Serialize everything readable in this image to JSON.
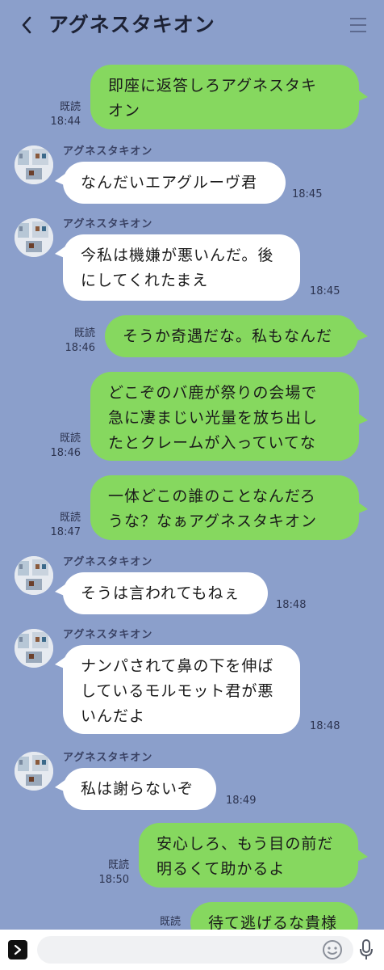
{
  "header": {
    "title": "アグネスタキオン",
    "icons": {
      "back": "chevron-left-icon",
      "menu": "hamburger-menu-icon"
    }
  },
  "colors": {
    "background": "#8b9fcb",
    "outgoing_bubble": "#86d85f",
    "incoming_bubble": "#ffffff"
  },
  "messages": [
    {
      "direction": "out",
      "text": "即座に返答しろアグネスタキ\nオン",
      "read": "既読",
      "time": "18:44"
    },
    {
      "direction": "in",
      "sender": "アグネスタキオン",
      "text": "なんだいエアグルーヴ君",
      "time": "18:45"
    },
    {
      "direction": "in",
      "sender": "アグネスタキオン",
      "text": "今私は機嫌が悪いんだ。後\nにしてくれたまえ",
      "time": "18:45"
    },
    {
      "direction": "out",
      "text": "そうか奇遇だな。私もなんだ",
      "read": "既読",
      "time": "18:46"
    },
    {
      "direction": "out",
      "text": "どこぞのバ鹿が祭りの会場で\n急に凄まじい光量を放ち出し\nたとクレームが入っていてな",
      "read": "既読",
      "time": "18:46"
    },
    {
      "direction": "out",
      "text": "一体どこの誰のことなんだろ\nうな？なぁアグネスタキオン",
      "read": "既読",
      "time": "18:47"
    },
    {
      "direction": "in",
      "sender": "アグネスタキオン",
      "text": "そうは言われてもねぇ",
      "time": "18:48"
    },
    {
      "direction": "in",
      "sender": "アグネスタキオン",
      "text": "ナンパされて鼻の下を伸ば\nしているモルモット君が悪\nいんだよ",
      "time": "18:48"
    },
    {
      "direction": "in",
      "sender": "アグネスタキオン",
      "text": "私は謝らないぞ",
      "time": "18:49"
    },
    {
      "direction": "out",
      "text": "安心しろ、もう目の前だ\n明るくて助かるよ",
      "read": "既読",
      "time": "18:50"
    },
    {
      "direction": "out",
      "text": "待て逃げるな貴様",
      "read": "既読",
      "time": ""
    }
  ],
  "input": {
    "placeholder": "",
    "icons": {
      "expand": "chevron-right-icon",
      "emoji": "smiley-icon",
      "voice": "microphone-icon"
    }
  }
}
